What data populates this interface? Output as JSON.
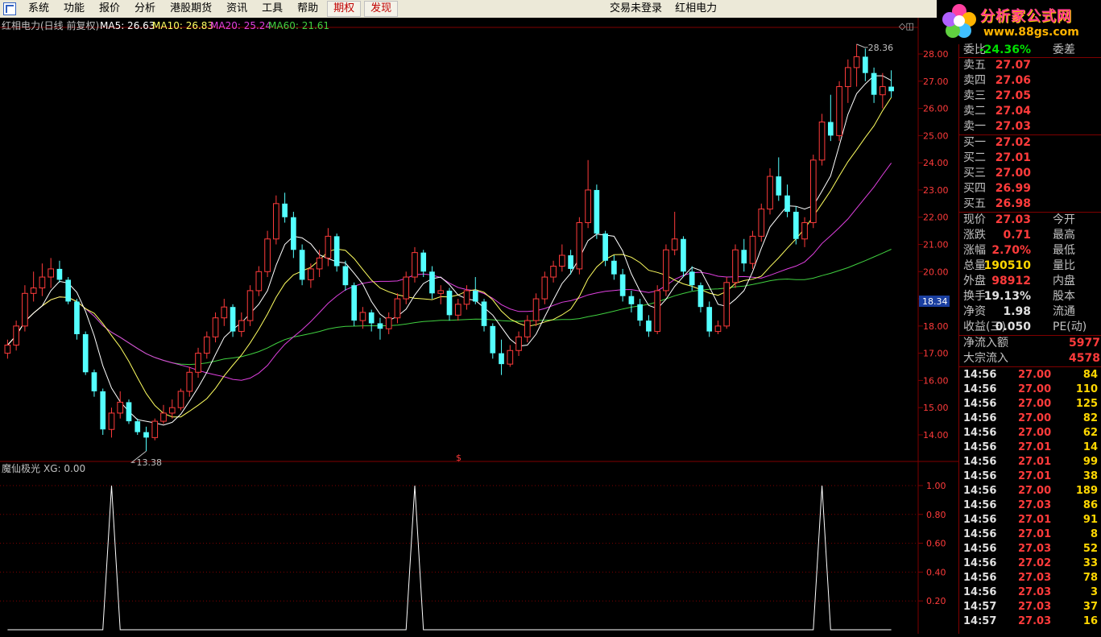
{
  "menu": {
    "items": [
      "系统",
      "功能",
      "报价",
      "分析",
      "港股期货",
      "资讯",
      "工具",
      "帮助"
    ],
    "highlight_items": [
      "期权",
      "发现"
    ],
    "status_text": "交易未登录",
    "stock_name": "红相电力"
  },
  "logo": {
    "brand": "分析家公式网",
    "url": "www.88gs.com"
  },
  "chart": {
    "stock_label": "红相电力(日线 前复权)",
    "ma5": "MA5: 26.63",
    "ma10": "MA10: 26.83",
    "ma20": "MA20: 25.24",
    "ma60": "MA60: 21.61",
    "high_label": "28.36",
    "low_label": "13.38",
    "current_price_tag": "18.34",
    "price_axis": [
      "28.00",
      "27.00",
      "26.00",
      "25.00",
      "24.00",
      "23.00",
      "22.00",
      "21.00",
      "20.00",
      "19.00",
      "18.00",
      "17.00",
      "16.00",
      "15.00",
      "14.00"
    ],
    "indicator_label": "魔仙极光",
    "indicator_value": "XG: 0.00",
    "indicator_axis": [
      "1.00",
      "0.80",
      "0.60",
      "0.40",
      "0.20"
    ],
    "colors": {
      "up": "#ff3b3b",
      "down": "#54ffff",
      "ma5": "#ffffff",
      "ma10": "#ffff60",
      "ma20": "#e040e0",
      "ma60": "#40d040"
    }
  },
  "chart_data": {
    "type": "candlestick",
    "ylim": [
      13.2,
      28.8
    ],
    "candles": [
      [
        17.0,
        17.5,
        16.8,
        17.3
      ],
      [
        17.3,
        18.2,
        17.1,
        18.0
      ],
      [
        18.0,
        19.5,
        17.8,
        19.2
      ],
      [
        19.2,
        20.0,
        18.9,
        19.4
      ],
      [
        19.4,
        20.3,
        19.1,
        19.8
      ],
      [
        19.8,
        20.5,
        19.4,
        20.1
      ],
      [
        20.1,
        20.4,
        19.6,
        19.7
      ],
      [
        19.7,
        19.8,
        18.8,
        18.9
      ],
      [
        18.9,
        19.0,
        17.5,
        17.7
      ],
      [
        17.7,
        17.8,
        16.2,
        16.3
      ],
      [
        16.3,
        16.4,
        15.4,
        15.6
      ],
      [
        15.6,
        15.7,
        14.0,
        14.2
      ],
      [
        14.2,
        15.0,
        13.9,
        14.8
      ],
      [
        14.8,
        15.6,
        14.6,
        15.2
      ],
      [
        15.2,
        15.3,
        14.4,
        14.5
      ],
      [
        14.5,
        14.6,
        14.0,
        14.1
      ],
      [
        14.1,
        14.3,
        13.4,
        13.9
      ],
      [
        13.9,
        14.6,
        13.8,
        14.5
      ],
      [
        14.5,
        15.1,
        14.4,
        14.8
      ],
      [
        14.8,
        15.3,
        14.6,
        15.0
      ],
      [
        15.0,
        15.7,
        14.9,
        15.6
      ],
      [
        15.6,
        16.5,
        15.4,
        16.3
      ],
      [
        16.3,
        17.2,
        16.1,
        17.0
      ],
      [
        17.0,
        17.8,
        16.8,
        17.6
      ],
      [
        17.6,
        18.5,
        17.4,
        18.3
      ],
      [
        18.3,
        19.0,
        18.0,
        18.7
      ],
      [
        18.7,
        18.8,
        17.6,
        17.8
      ],
      [
        17.8,
        18.5,
        17.6,
        18.2
      ],
      [
        18.2,
        19.5,
        18.0,
        19.3
      ],
      [
        19.3,
        20.2,
        19.1,
        20.0
      ],
      [
        20.0,
        21.5,
        19.8,
        21.2
      ],
      [
        21.2,
        22.8,
        21.0,
        22.5
      ],
      [
        22.5,
        22.9,
        21.8,
        22.0
      ],
      [
        22.0,
        22.2,
        20.5,
        20.8
      ],
      [
        20.8,
        21.0,
        19.5,
        19.7
      ],
      [
        19.7,
        20.3,
        19.4,
        20.1
      ],
      [
        20.1,
        20.8,
        19.8,
        20.5
      ],
      [
        20.5,
        21.6,
        20.2,
        21.3
      ],
      [
        21.3,
        21.4,
        20.0,
        20.2
      ],
      [
        20.2,
        20.4,
        19.3,
        19.5
      ],
      [
        19.5,
        19.6,
        18.0,
        18.2
      ],
      [
        18.2,
        18.7,
        17.9,
        18.5
      ],
      [
        18.5,
        18.6,
        17.8,
        18.1
      ],
      [
        18.1,
        18.3,
        17.5,
        17.9
      ],
      [
        17.9,
        18.5,
        17.7,
        18.3
      ],
      [
        18.3,
        19.2,
        18.1,
        19.0
      ],
      [
        19.0,
        20.0,
        18.8,
        19.8
      ],
      [
        19.8,
        20.9,
        19.6,
        20.7
      ],
      [
        20.7,
        20.8,
        19.8,
        20.0
      ],
      [
        20.0,
        20.2,
        19.0,
        19.2
      ],
      [
        19.2,
        19.5,
        18.8,
        19.3
      ],
      [
        19.3,
        19.4,
        18.2,
        18.4
      ],
      [
        18.4,
        19.0,
        18.2,
        18.8
      ],
      [
        18.8,
        19.5,
        18.6,
        19.3
      ],
      [
        19.3,
        19.8,
        18.8,
        18.9
      ],
      [
        18.9,
        19.0,
        17.8,
        18.0
      ],
      [
        18.0,
        18.1,
        16.8,
        17.0
      ],
      [
        17.0,
        17.5,
        16.2,
        16.6
      ],
      [
        16.6,
        17.3,
        16.5,
        17.1
      ],
      [
        17.1,
        17.8,
        16.9,
        17.6
      ],
      [
        17.6,
        18.4,
        17.4,
        18.2
      ],
      [
        18.2,
        19.2,
        18.0,
        19.0
      ],
      [
        19.0,
        20.0,
        18.8,
        19.8
      ],
      [
        19.8,
        20.4,
        19.6,
        20.2
      ],
      [
        20.2,
        21.0,
        20.0,
        20.6
      ],
      [
        20.6,
        20.8,
        19.9,
        20.1
      ],
      [
        20.1,
        22.0,
        19.9,
        21.8
      ],
      [
        21.8,
        24.1,
        21.6,
        23.0
      ],
      [
        23.0,
        23.2,
        21.2,
        21.4
      ],
      [
        21.4,
        21.5,
        20.2,
        20.4
      ],
      [
        20.4,
        20.6,
        19.7,
        19.9
      ],
      [
        19.9,
        20.1,
        18.9,
        19.1
      ],
      [
        19.1,
        19.3,
        18.5,
        18.8
      ],
      [
        18.8,
        19.0,
        18.0,
        18.2
      ],
      [
        18.2,
        18.4,
        17.6,
        17.8
      ],
      [
        17.8,
        19.5,
        17.7,
        19.3
      ],
      [
        19.3,
        21.0,
        19.1,
        20.8
      ],
      [
        20.8,
        22.2,
        20.6,
        21.2
      ],
      [
        21.2,
        21.3,
        19.8,
        20.0
      ],
      [
        20.0,
        20.2,
        19.3,
        19.5
      ],
      [
        19.5,
        19.6,
        18.5,
        18.7
      ],
      [
        18.7,
        18.9,
        17.6,
        17.8
      ],
      [
        17.8,
        18.2,
        17.7,
        18.0
      ],
      [
        18.0,
        19.8,
        17.9,
        19.6
      ],
      [
        19.6,
        21.0,
        19.4,
        20.8
      ],
      [
        20.8,
        21.2,
        20.0,
        20.3
      ],
      [
        20.3,
        21.5,
        20.1,
        21.3
      ],
      [
        21.3,
        22.5,
        21.1,
        22.3
      ],
      [
        22.3,
        23.8,
        22.1,
        23.5
      ],
      [
        23.5,
        24.2,
        22.6,
        22.8
      ],
      [
        22.8,
        23.2,
        22.0,
        22.2
      ],
      [
        22.2,
        22.4,
        21.0,
        21.2
      ],
      [
        21.2,
        22.0,
        20.9,
        21.8
      ],
      [
        21.8,
        24.3,
        21.6,
        24.1
      ],
      [
        24.1,
        25.8,
        23.9,
        25.5
      ],
      [
        25.5,
        26.5,
        24.8,
        25.0
      ],
      [
        25.0,
        27.0,
        24.8,
        26.8
      ],
      [
        26.8,
        27.8,
        26.2,
        27.5
      ],
      [
        27.5,
        28.36,
        26.8,
        27.9
      ],
      [
        27.9,
        28.2,
        27.0,
        27.3
      ],
      [
        27.3,
        27.5,
        26.2,
        26.5
      ],
      [
        26.5,
        27.3,
        26.0,
        26.8
      ],
      [
        26.8,
        27.4,
        26.4,
        26.63
      ]
    ],
    "signal_x_index": [
      12,
      47,
      94
    ],
    "indicator_ylim": [
      0,
      1.05
    ]
  },
  "quote": {
    "header": {
      "label": "委比",
      "value": "-24.36%",
      "label2": "委差"
    },
    "asks": [
      {
        "label": "卖五",
        "price": "27.07"
      },
      {
        "label": "卖四",
        "price": "27.06"
      },
      {
        "label": "卖三",
        "price": "27.05"
      },
      {
        "label": "卖二",
        "price": "27.04"
      },
      {
        "label": "卖一",
        "price": "27.03"
      }
    ],
    "bids": [
      {
        "label": "买一",
        "price": "27.02"
      },
      {
        "label": "买二",
        "price": "27.01"
      },
      {
        "label": "买三",
        "price": "27.00"
      },
      {
        "label": "买四",
        "price": "26.99"
      },
      {
        "label": "买五",
        "price": "26.98"
      }
    ],
    "stats": [
      {
        "label": "现价",
        "value": "27.03",
        "label2": "今开",
        "color": "red"
      },
      {
        "label": "涨跌",
        "value": "0.71",
        "label2": "最高",
        "color": "red"
      },
      {
        "label": "涨幅",
        "value": "2.70%",
        "label2": "最低",
        "color": "red"
      },
      {
        "label": "总量",
        "value": "190510",
        "label2": "量比",
        "color": "yellow"
      },
      {
        "label": "外盘",
        "value": "98912",
        "label2": "内盘",
        "color": "red"
      },
      {
        "label": "换手",
        "value": "19.13%",
        "label2": "股本",
        "color": "white"
      },
      {
        "label": "净资",
        "value": "1.98",
        "label2": "流通",
        "color": "white"
      },
      {
        "label": "收益(三)",
        "value": "0.050",
        "label2": "PE(动)",
        "color": "white"
      }
    ],
    "flows": [
      {
        "label": "净流入额",
        "value": "5977"
      },
      {
        "label": "大宗流入",
        "value": "4578"
      }
    ],
    "ticks": [
      {
        "time": "14:56",
        "price": "27.00",
        "vol": "84"
      },
      {
        "time": "14:56",
        "price": "27.00",
        "vol": "110"
      },
      {
        "time": "14:56",
        "price": "27.00",
        "vol": "125"
      },
      {
        "time": "14:56",
        "price": "27.00",
        "vol": "82"
      },
      {
        "time": "14:56",
        "price": "27.00",
        "vol": "62"
      },
      {
        "time": "14:56",
        "price": "27.01",
        "vol": "14"
      },
      {
        "time": "14:56",
        "price": "27.01",
        "vol": "99"
      },
      {
        "time": "14:56",
        "price": "27.01",
        "vol": "38"
      },
      {
        "time": "14:56",
        "price": "27.00",
        "vol": "189"
      },
      {
        "time": "14:56",
        "price": "27.03",
        "vol": "86"
      },
      {
        "time": "14:56",
        "price": "27.01",
        "vol": "91"
      },
      {
        "time": "14:56",
        "price": "27.01",
        "vol": "8"
      },
      {
        "time": "14:56",
        "price": "27.03",
        "vol": "52"
      },
      {
        "time": "14:56",
        "price": "27.02",
        "vol": "33"
      },
      {
        "time": "14:56",
        "price": "27.03",
        "vol": "78"
      },
      {
        "time": "14:56",
        "price": "27.03",
        "vol": "3"
      },
      {
        "time": "14:57",
        "price": "27.03",
        "vol": "37"
      },
      {
        "time": "14:57",
        "price": "27.03",
        "vol": "16"
      }
    ]
  }
}
